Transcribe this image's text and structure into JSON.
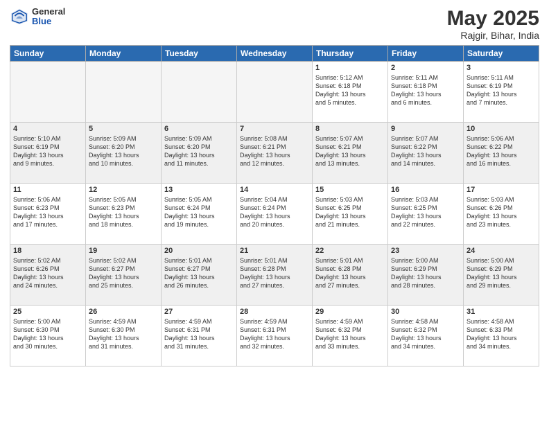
{
  "logo": {
    "general": "General",
    "blue": "Blue"
  },
  "title": "May 2025",
  "location": "Rajgir, Bihar, India",
  "days": [
    "Sunday",
    "Monday",
    "Tuesday",
    "Wednesday",
    "Thursday",
    "Friday",
    "Saturday"
  ],
  "weeks": [
    [
      {
        "day": "",
        "info": "",
        "empty": true
      },
      {
        "day": "",
        "info": "",
        "empty": true
      },
      {
        "day": "",
        "info": "",
        "empty": true
      },
      {
        "day": "",
        "info": "",
        "empty": true
      },
      {
        "day": "1",
        "info": "Sunrise: 5:12 AM\nSunset: 6:18 PM\nDaylight: 13 hours\nand 5 minutes.",
        "empty": false
      },
      {
        "day": "2",
        "info": "Sunrise: 5:11 AM\nSunset: 6:18 PM\nDaylight: 13 hours\nand 6 minutes.",
        "empty": false
      },
      {
        "day": "3",
        "info": "Sunrise: 5:11 AM\nSunset: 6:19 PM\nDaylight: 13 hours\nand 7 minutes.",
        "empty": false
      }
    ],
    [
      {
        "day": "4",
        "info": "Sunrise: 5:10 AM\nSunset: 6:19 PM\nDaylight: 13 hours\nand 9 minutes.",
        "empty": false
      },
      {
        "day": "5",
        "info": "Sunrise: 5:09 AM\nSunset: 6:20 PM\nDaylight: 13 hours\nand 10 minutes.",
        "empty": false
      },
      {
        "day": "6",
        "info": "Sunrise: 5:09 AM\nSunset: 6:20 PM\nDaylight: 13 hours\nand 11 minutes.",
        "empty": false
      },
      {
        "day": "7",
        "info": "Sunrise: 5:08 AM\nSunset: 6:21 PM\nDaylight: 13 hours\nand 12 minutes.",
        "empty": false
      },
      {
        "day": "8",
        "info": "Sunrise: 5:07 AM\nSunset: 6:21 PM\nDaylight: 13 hours\nand 13 minutes.",
        "empty": false
      },
      {
        "day": "9",
        "info": "Sunrise: 5:07 AM\nSunset: 6:22 PM\nDaylight: 13 hours\nand 14 minutes.",
        "empty": false
      },
      {
        "day": "10",
        "info": "Sunrise: 5:06 AM\nSunset: 6:22 PM\nDaylight: 13 hours\nand 16 minutes.",
        "empty": false
      }
    ],
    [
      {
        "day": "11",
        "info": "Sunrise: 5:06 AM\nSunset: 6:23 PM\nDaylight: 13 hours\nand 17 minutes.",
        "empty": false
      },
      {
        "day": "12",
        "info": "Sunrise: 5:05 AM\nSunset: 6:23 PM\nDaylight: 13 hours\nand 18 minutes.",
        "empty": false
      },
      {
        "day": "13",
        "info": "Sunrise: 5:05 AM\nSunset: 6:24 PM\nDaylight: 13 hours\nand 19 minutes.",
        "empty": false
      },
      {
        "day": "14",
        "info": "Sunrise: 5:04 AM\nSunset: 6:24 PM\nDaylight: 13 hours\nand 20 minutes.",
        "empty": false
      },
      {
        "day": "15",
        "info": "Sunrise: 5:03 AM\nSunset: 6:25 PM\nDaylight: 13 hours\nand 21 minutes.",
        "empty": false
      },
      {
        "day": "16",
        "info": "Sunrise: 5:03 AM\nSunset: 6:25 PM\nDaylight: 13 hours\nand 22 minutes.",
        "empty": false
      },
      {
        "day": "17",
        "info": "Sunrise: 5:03 AM\nSunset: 6:26 PM\nDaylight: 13 hours\nand 23 minutes.",
        "empty": false
      }
    ],
    [
      {
        "day": "18",
        "info": "Sunrise: 5:02 AM\nSunset: 6:26 PM\nDaylight: 13 hours\nand 24 minutes.",
        "empty": false
      },
      {
        "day": "19",
        "info": "Sunrise: 5:02 AM\nSunset: 6:27 PM\nDaylight: 13 hours\nand 25 minutes.",
        "empty": false
      },
      {
        "day": "20",
        "info": "Sunrise: 5:01 AM\nSunset: 6:27 PM\nDaylight: 13 hours\nand 26 minutes.",
        "empty": false
      },
      {
        "day": "21",
        "info": "Sunrise: 5:01 AM\nSunset: 6:28 PM\nDaylight: 13 hours\nand 27 minutes.",
        "empty": false
      },
      {
        "day": "22",
        "info": "Sunrise: 5:01 AM\nSunset: 6:28 PM\nDaylight: 13 hours\nand 27 minutes.",
        "empty": false
      },
      {
        "day": "23",
        "info": "Sunrise: 5:00 AM\nSunset: 6:29 PM\nDaylight: 13 hours\nand 28 minutes.",
        "empty": false
      },
      {
        "day": "24",
        "info": "Sunrise: 5:00 AM\nSunset: 6:29 PM\nDaylight: 13 hours\nand 29 minutes.",
        "empty": false
      }
    ],
    [
      {
        "day": "25",
        "info": "Sunrise: 5:00 AM\nSunset: 6:30 PM\nDaylight: 13 hours\nand 30 minutes.",
        "empty": false
      },
      {
        "day": "26",
        "info": "Sunrise: 4:59 AM\nSunset: 6:30 PM\nDaylight: 13 hours\nand 31 minutes.",
        "empty": false
      },
      {
        "day": "27",
        "info": "Sunrise: 4:59 AM\nSunset: 6:31 PM\nDaylight: 13 hours\nand 31 minutes.",
        "empty": false
      },
      {
        "day": "28",
        "info": "Sunrise: 4:59 AM\nSunset: 6:31 PM\nDaylight: 13 hours\nand 32 minutes.",
        "empty": false
      },
      {
        "day": "29",
        "info": "Sunrise: 4:59 AM\nSunset: 6:32 PM\nDaylight: 13 hours\nand 33 minutes.",
        "empty": false
      },
      {
        "day": "30",
        "info": "Sunrise: 4:58 AM\nSunset: 6:32 PM\nDaylight: 13 hours\nand 34 minutes.",
        "empty": false
      },
      {
        "day": "31",
        "info": "Sunrise: 4:58 AM\nSunset: 6:33 PM\nDaylight: 13 hours\nand 34 minutes.",
        "empty": false
      }
    ]
  ]
}
